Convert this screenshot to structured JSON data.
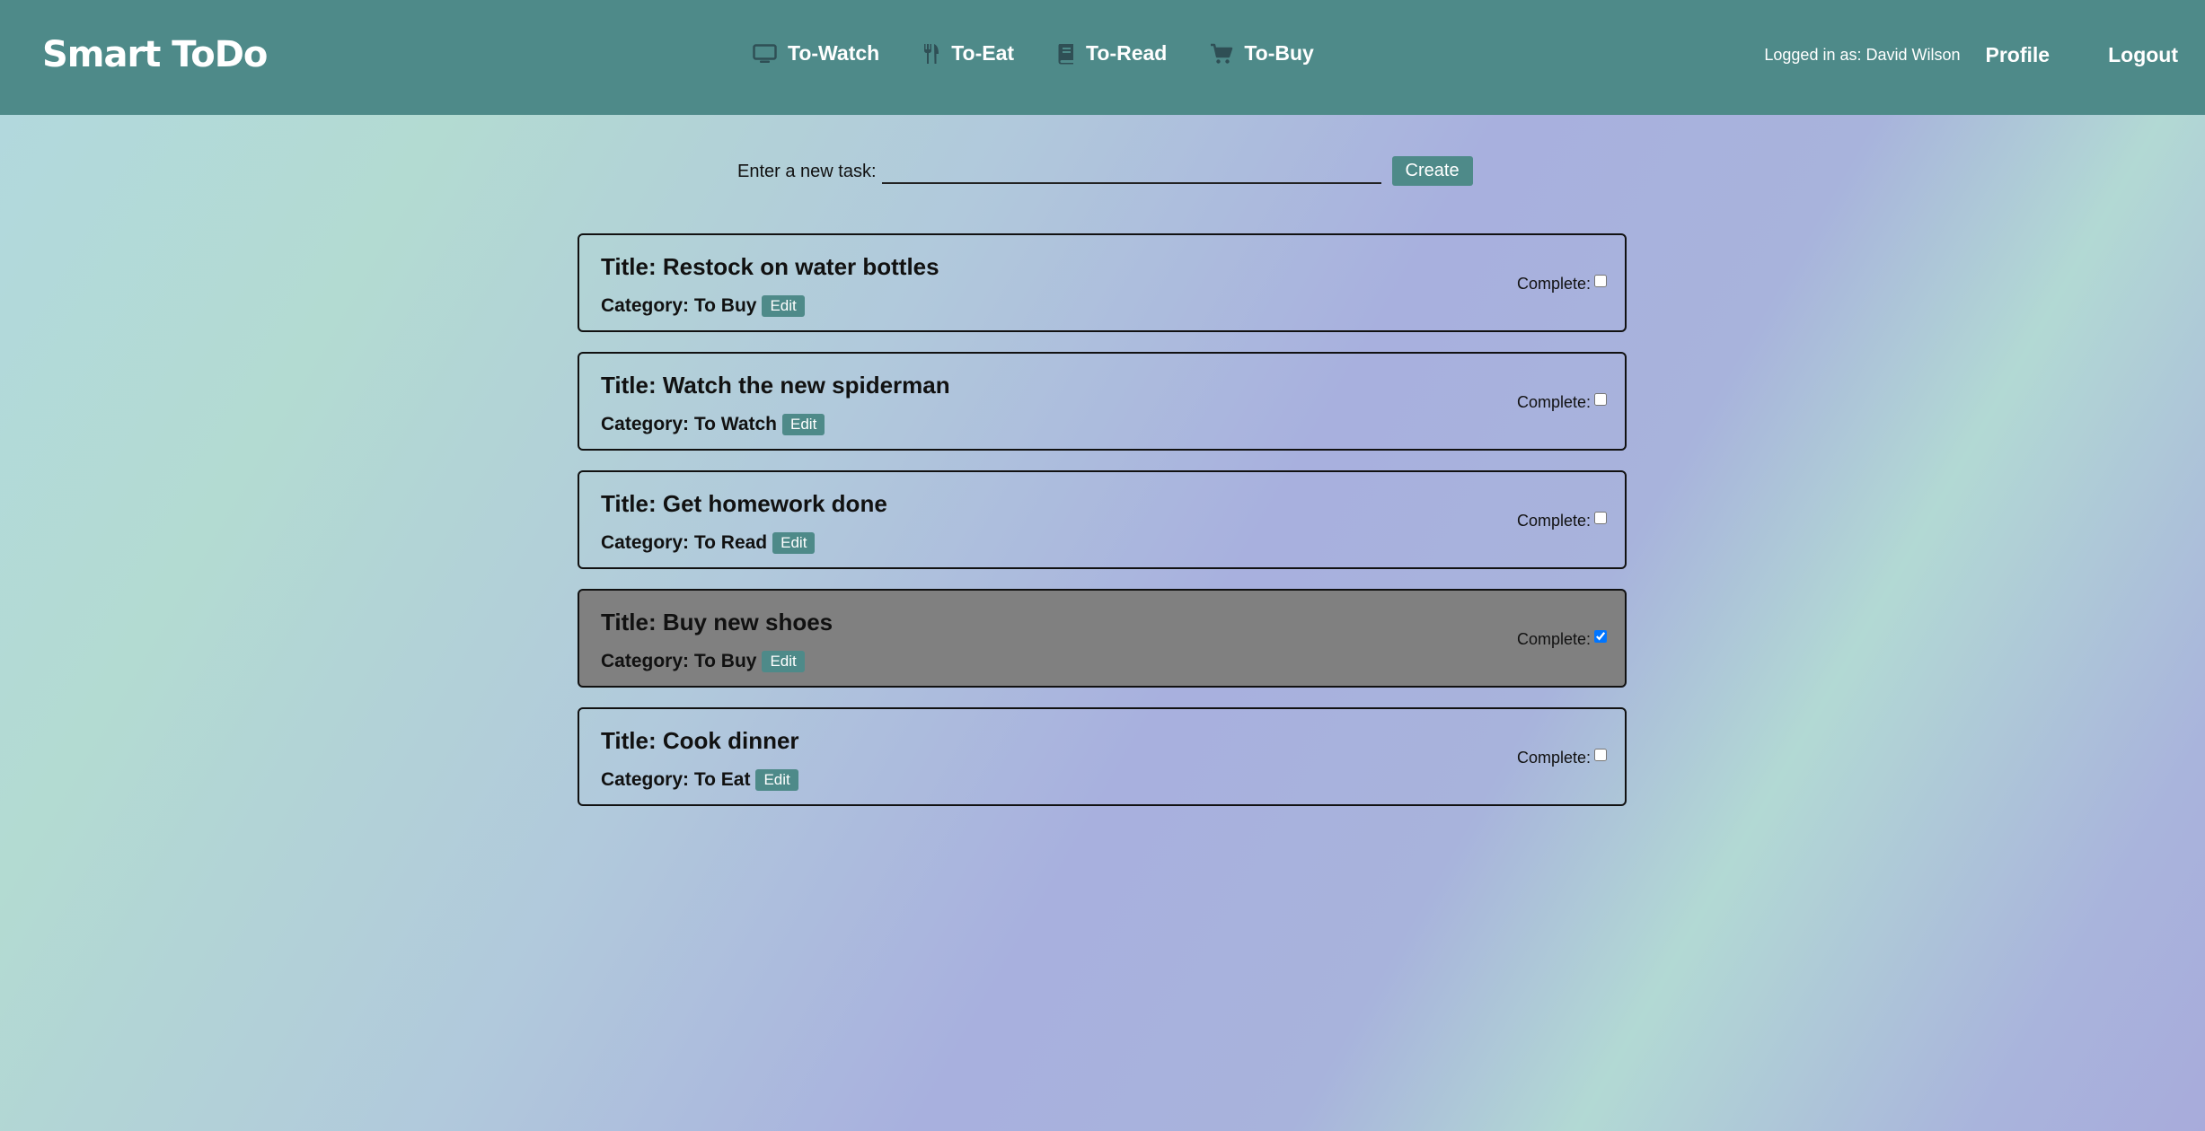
{
  "brand": "Smart ToDo",
  "nav": [
    {
      "label": "To-Watch",
      "icon": "tv-icon"
    },
    {
      "label": "To-Eat",
      "icon": "utensils-icon"
    },
    {
      "label": "To-Read",
      "icon": "book-icon"
    },
    {
      "label": "To-Buy",
      "icon": "shopping-cart-icon"
    }
  ],
  "user": {
    "logged_in_text": "Logged in as: David Wilson",
    "profile_label": "Profile",
    "logout_label": "Logout"
  },
  "form": {
    "label": "Enter a new task:",
    "value": "",
    "placeholder": "",
    "create_label": "Create"
  },
  "tasks": [
    {
      "title": "Title: Restock on water bottles",
      "category": "Category: To Buy",
      "edit_label": "Edit",
      "complete_label": "Complete:",
      "complete": false
    },
    {
      "title": "Title: Watch the new spiderman",
      "category": "Category: To Watch",
      "edit_label": "Edit",
      "complete_label": "Complete:",
      "complete": false
    },
    {
      "title": "Title: Get homework done",
      "category": "Category: To Read",
      "edit_label": "Edit",
      "complete_label": "Complete:",
      "complete": false
    },
    {
      "title": "Title: Buy new shoes",
      "category": "Category: To Buy",
      "edit_label": "Edit",
      "complete_label": "Complete:",
      "complete": true
    },
    {
      "title": "Title: Cook dinner",
      "category": "Category: To Eat",
      "edit_label": "Edit",
      "complete_label": "Complete:",
      "complete": false
    }
  ],
  "colors": {
    "navbar": "#4e8a89",
    "button": "#4e8a89",
    "completed_card": "#808080"
  }
}
